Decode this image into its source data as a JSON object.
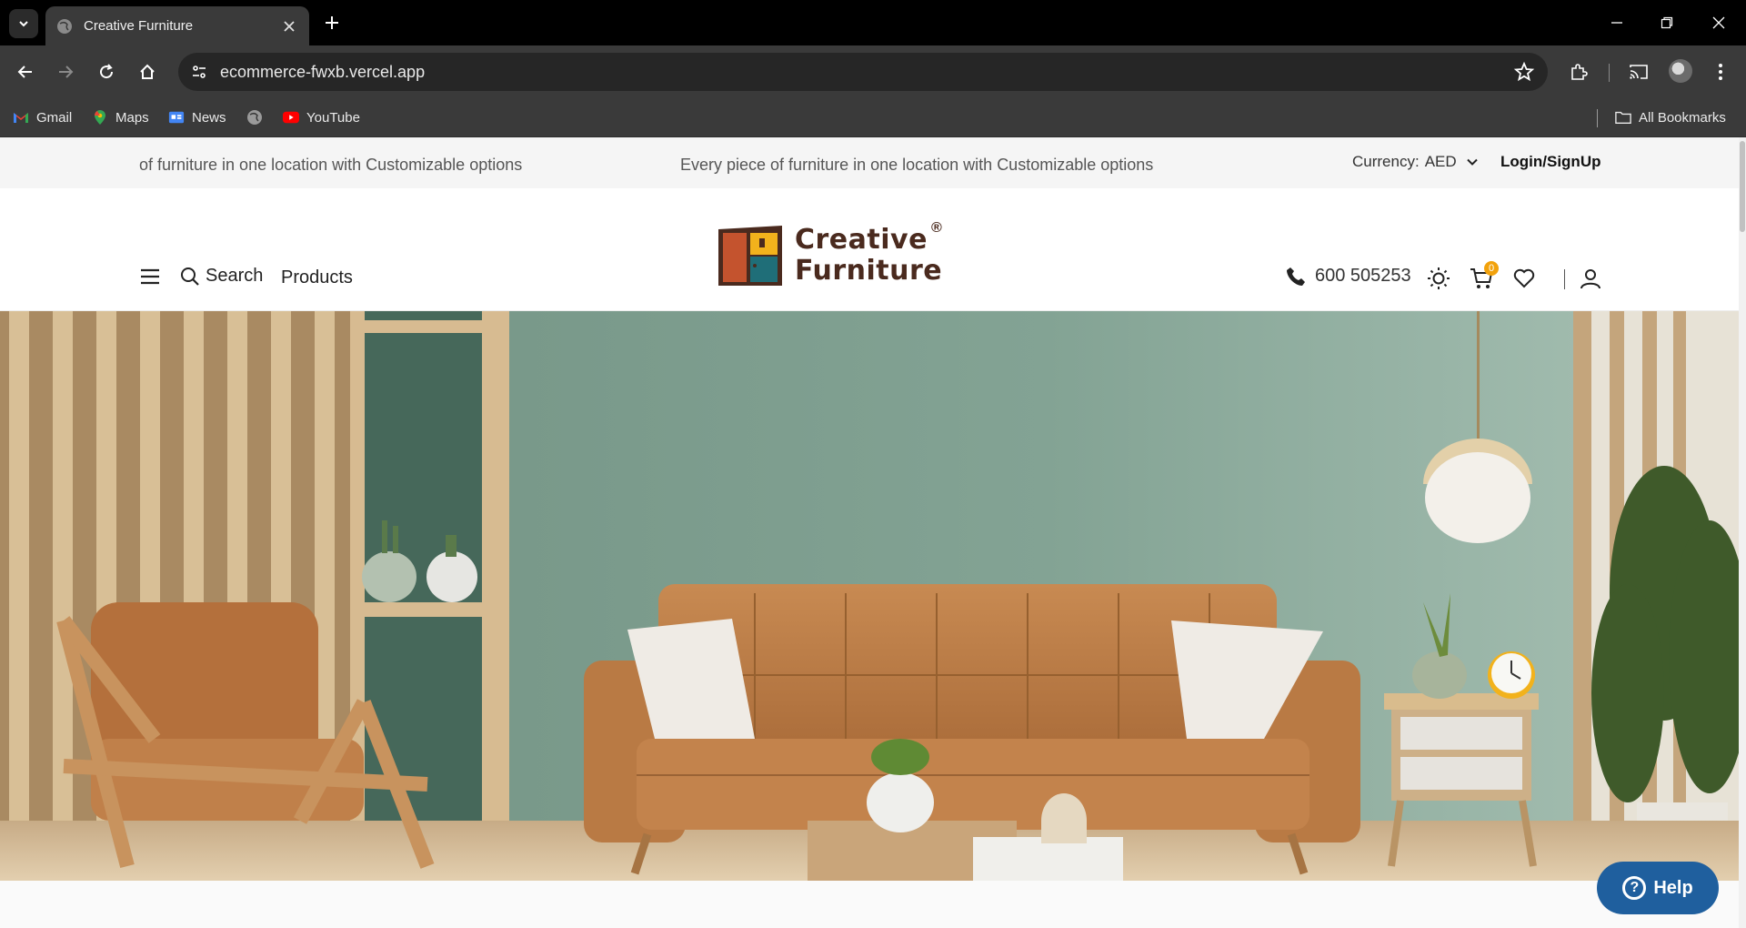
{
  "browser": {
    "tab_title": "Creative Furniture",
    "url": "ecommerce-fwxb.vercel.app",
    "bookmarks": [
      "Gmail",
      "Maps",
      "News",
      "YouTube"
    ],
    "all_bookmarks": "All Bookmarks"
  },
  "site": {
    "announcement_left": "of furniture in one location with Customizable options",
    "announcement_center": "Every piece of furniture in one location with Customizable options",
    "currency_label": "Currency:",
    "currency_value": "AED",
    "login": "Login/SignUp",
    "nav_search": "Search",
    "nav_products": "Products",
    "logo_line1": "Creative",
    "logo_line2": "Furniture",
    "logo_reg": "®",
    "phone": "600 505253",
    "cart_count": "0",
    "help": "Help"
  },
  "colors": {
    "brand_brown": "#4a2a1e",
    "brand_orange": "#c4532e",
    "brand_teal": "#1f6e78",
    "brand_yellow": "#f2b21c",
    "help_blue": "#1f5f9e",
    "badge": "#f2a20c"
  }
}
